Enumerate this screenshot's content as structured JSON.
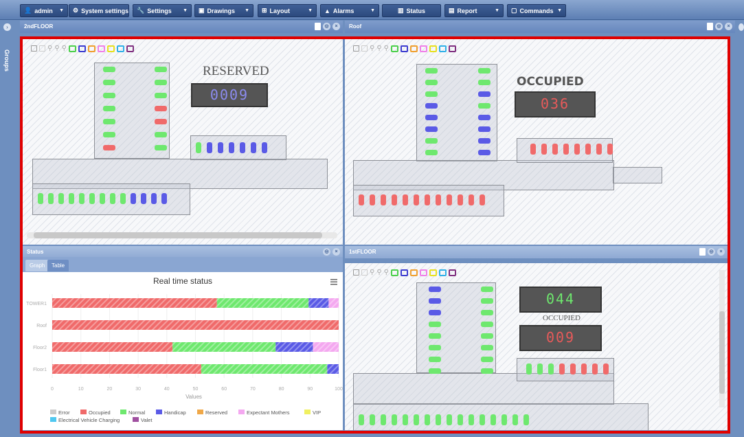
{
  "toolbar": {
    "items": [
      {
        "label": "admin",
        "icon": "user-icon"
      },
      {
        "label": "System settings",
        "icon": "gear-icon"
      },
      {
        "label": "Settings",
        "icon": "wrench-icon"
      },
      {
        "label": "Drawings",
        "icon": "image-icon"
      },
      {
        "label": "Layout",
        "icon": "layout-icon"
      },
      {
        "label": "Alarms",
        "icon": "warning-icon"
      },
      {
        "label": "Status",
        "icon": "bar-chart-icon"
      },
      {
        "label": "Report",
        "icon": "document-icon"
      },
      {
        "label": "Commands",
        "icon": "command-icon"
      }
    ]
  },
  "sidebar": {
    "label": "Groups"
  },
  "panels": {
    "p1": {
      "title": "2ndFLOOR",
      "sign_title": "RESERVED",
      "sign_value": "0009"
    },
    "p2": {
      "title": "Roof",
      "sign_title": "OCCUPIED",
      "sign_value": "036"
    },
    "p3": {
      "title": "Status",
      "tabs": [
        "Graph",
        "Table"
      ]
    },
    "p4": {
      "title": "1stFLOOR",
      "sign_value_top": "044",
      "sign_title": "OCCUPIED",
      "sign_value_bottom": "009"
    }
  },
  "colors": {
    "occupied": "#f06a6a",
    "normal": "#6ee86e",
    "handicap": "#5a5ae6",
    "expectant": "#f4a8f0",
    "frame": "#e00000"
  },
  "chart_data": {
    "type": "bar",
    "orientation": "horizontal",
    "stacked": true,
    "title": "Real time status",
    "categories": [
      "TOWER1",
      "Roof",
      "Floor2",
      "Floor1"
    ],
    "xlabel": "Values",
    "xlim": [
      0,
      100
    ],
    "xticks": [
      0,
      10,
      20,
      30,
      40,
      50,
      60,
      70,
      80,
      90,
      100
    ],
    "series": [
      {
        "name": "Error",
        "color": "#cccccc",
        "values": [
          0,
          0,
          0,
          0
        ]
      },
      {
        "name": "Occupied",
        "color": "#f06a6a",
        "values": [
          57.5,
          100,
          42,
          52
        ]
      },
      {
        "name": "Normal",
        "color": "#6ee86e",
        "values": [
          32,
          0,
          36,
          44
        ]
      },
      {
        "name": "Handicap",
        "color": "#5a5ae6",
        "values": [
          7,
          0,
          13,
          4
        ]
      },
      {
        "name": "Reserved",
        "color": "#f0a848",
        "values": [
          0,
          0,
          0,
          0
        ]
      },
      {
        "name": "Expectant Mothers",
        "color": "#f4a8f0",
        "values": [
          3.5,
          0,
          9,
          0
        ]
      },
      {
        "name": "VIP",
        "color": "#f0f060",
        "values": [
          0,
          0,
          0,
          0
        ]
      },
      {
        "name": "Electrical Vehicle Charging",
        "color": "#50c8f0",
        "values": [
          0,
          0,
          0,
          0
        ]
      },
      {
        "name": "Valet",
        "color": "#a050a0",
        "values": [
          0,
          0,
          0,
          0
        ]
      }
    ],
    "legend": "bottom"
  }
}
